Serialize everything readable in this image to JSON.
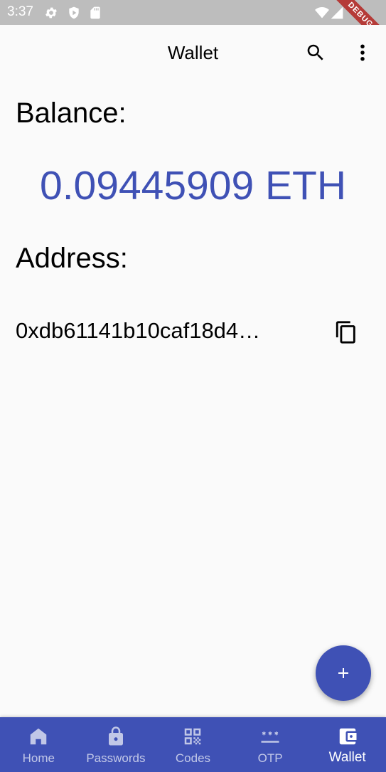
{
  "status_bar": {
    "time": "3:37",
    "debug_banner": "DEBUG"
  },
  "app_bar": {
    "title": "Wallet",
    "actions": [
      "search-icon",
      "more-vert-icon"
    ]
  },
  "balance": {
    "label": "Balance:",
    "value": "0.09445909 ETH"
  },
  "address": {
    "label": "Address:",
    "value": "0xdb61141b10caf18d4…"
  },
  "fab": {
    "icon": "add-icon"
  },
  "bottom_nav": {
    "items": [
      {
        "label": "Home",
        "icon": "home-icon"
      },
      {
        "label": "Passwords",
        "icon": "lock-icon"
      },
      {
        "label": "Codes",
        "icon": "qr-code-icon"
      },
      {
        "label": "OTP",
        "icon": "password-dots-icon"
      },
      {
        "label": "Wallet",
        "icon": "wallet-icon",
        "active": true
      }
    ]
  },
  "colors": {
    "primary": "#3f51b5",
    "background": "#fafafa",
    "status_bar": "#bdbdbd"
  }
}
